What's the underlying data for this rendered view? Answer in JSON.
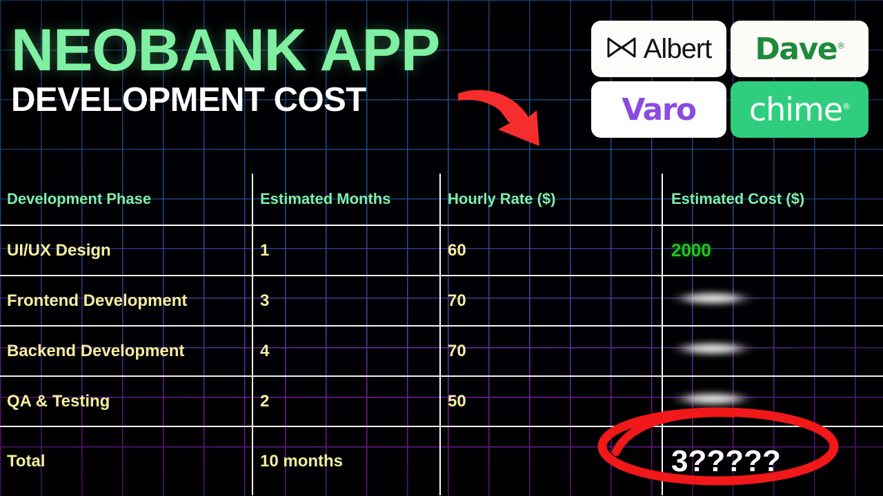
{
  "headline": {
    "title": "NEOBANK APP",
    "subtitle": "DEVELOPMENT COST",
    "title_color": "#7FEFA1",
    "subtitle_color": "#FFFFFF"
  },
  "arrow": {
    "name": "curved-red-arrow",
    "color": "#F52D2D"
  },
  "logos": [
    {
      "name": "albert",
      "label": "Albert",
      "text_color": "#121212",
      "card_color": "#FCFCFA",
      "has_icon": true,
      "icon": "bowtie-icon"
    },
    {
      "name": "dave",
      "label": "Dave",
      "display": "Dave",
      "text_color": "#1E8A3C",
      "card_color": "#FCFCF7",
      "registered": "®"
    },
    {
      "name": "varo",
      "label": "Varo",
      "text_color": "#8B4BE0",
      "card_color": "#FFFFFF"
    },
    {
      "name": "chime",
      "label": "chime",
      "text_color": "#FFFFFF",
      "card_color": "#2FCE7F",
      "registered": "®"
    }
  ],
  "table": {
    "header_color": "#7FEFA8",
    "row_color": "#F5EE9E",
    "columns": [
      "Development Phase",
      "Estimated Months",
      "Hourly Rate ($)",
      "Estimated Cost ($)"
    ],
    "rows": [
      {
        "phase": "UI/UX Design",
        "months": "1",
        "rate": "60",
        "cost": "2000",
        "cost_state": "visible",
        "cost_color": "#22C31F"
      },
      {
        "phase": "Frontend Development",
        "months": "3",
        "rate": "70",
        "cost": "",
        "cost_state": "redacted",
        "cost_color": ""
      },
      {
        "phase": "Backend Development",
        "months": "4",
        "rate": "70",
        "cost": "",
        "cost_state": "redacted",
        "cost_color": ""
      },
      {
        "phase": "QA & Testing",
        "months": "2",
        "rate": "50",
        "cost": "",
        "cost_state": "redacted",
        "cost_color": ""
      }
    ],
    "total": {
      "phase": "Total",
      "months": "10 months",
      "rate": "",
      "cost": "3?????",
      "cost_color": "#FFFFFF",
      "highlight": "red-ellipse-annotation"
    }
  },
  "background": {
    "base_color": "#000004",
    "grid_blue": "#285FA5",
    "grid_purple": "#961EBE"
  }
}
